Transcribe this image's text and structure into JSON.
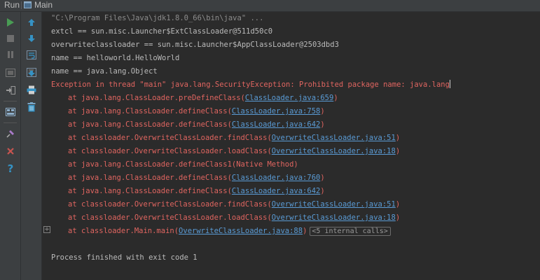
{
  "title_bar": {
    "run_label": "Run",
    "tab_label": "Main"
  },
  "colors": {
    "run_green": "#499c54",
    "stop_gray": "#6e6e6e",
    "close_red": "#c75450",
    "help_blue": "#3592c4",
    "error_text": "#e06560",
    "link": "#5a9bd5"
  },
  "left_toolbar": [
    "rerun-icon",
    "stop-icon",
    "pause-icon",
    "dump-threads-icon",
    "exit-icon",
    "layout-icon",
    "pin-icon",
    "close-icon",
    "help-icon"
  ],
  "right_toolbar": [
    "scroll-up-icon",
    "scroll-down-icon",
    "soft-wrap-icon",
    "scroll-to-end-icon",
    "print-icon",
    "clear-all-icon"
  ],
  "console": {
    "command": "\"C:\\Program Files\\Java\\jdk1.8.0_66\\bin\\java\" ...",
    "out1": "extcl == sun.misc.Launcher$ExtClassLoader@511d50c0",
    "out2": "overwriteclassloader == sun.misc.Launcher$AppClassLoader@2503dbd3",
    "out3": "name == helloworld.HelloWorld",
    "out4": "name == java.lang.Object",
    "exception": "Exception in thread \"main\" java.lang.SecurityException: Prohibited package name: java.lang",
    "frames": [
      {
        "at": "at java.lang.ClassLoader.preDefineClass(",
        "link": "ClassLoader.java:659",
        "end": ")"
      },
      {
        "at": "at java.lang.ClassLoader.defineClass(",
        "link": "ClassLoader.java:758",
        "end": ")"
      },
      {
        "at": "at java.lang.ClassLoader.defineClass(",
        "link": "ClassLoader.java:642",
        "end": ")"
      },
      {
        "at": "at classloader.OverwriteClassLoader.findClass(",
        "link": "OverwriteClassLoader.java:51",
        "end": ")"
      },
      {
        "at": "at classloader.OverwriteClassLoader.loadClass(",
        "link": "OverwriteClassLoader.java:18",
        "end": ")"
      },
      {
        "at": "at java.lang.ClassLoader.defineClass1(Native Method)"
      },
      {
        "at": "at java.lang.ClassLoader.defineClass(",
        "link": "ClassLoader.java:760",
        "end": ")"
      },
      {
        "at": "at java.lang.ClassLoader.defineClass(",
        "link": "ClassLoader.java:642",
        "end": ")"
      },
      {
        "at": "at classloader.OverwriteClassLoader.findClass(",
        "link": "OverwriteClassLoader.java:51",
        "end": ")"
      },
      {
        "at": "at classloader.OverwriteClassLoader.loadClass(",
        "link": "OverwriteClassLoader.java:18",
        "end": ")"
      },
      {
        "at": "at classloader.Main.main(",
        "link": "OverwriteClassLoader.java:88",
        "end": ")",
        "folded": "<5 internal calls>"
      }
    ],
    "finished": "Process finished with exit code 1"
  }
}
